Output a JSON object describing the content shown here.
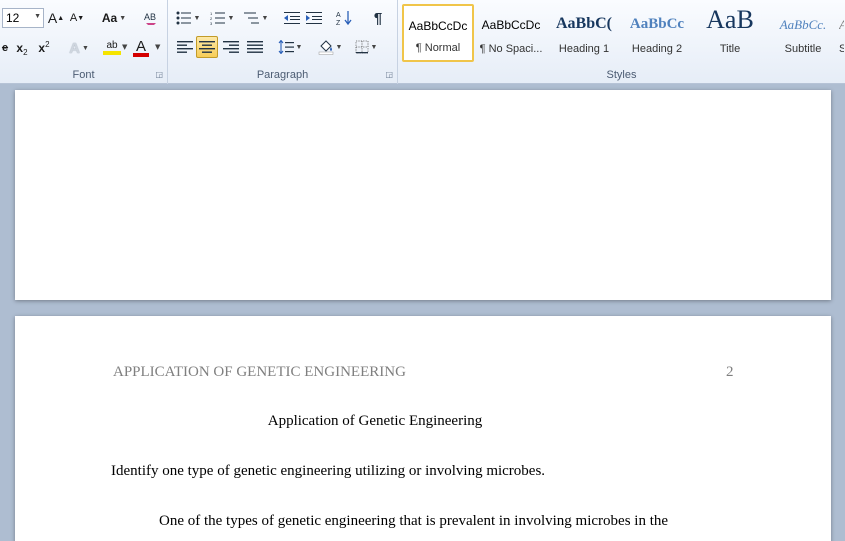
{
  "font_group": {
    "label": "Font",
    "font_size": "12",
    "grow_font": "A",
    "shrink_font": "A",
    "change_case": "Aa",
    "clear_format": "A",
    "subscript": "x",
    "superscript": "x",
    "text_effects": "A",
    "highlight": "ab",
    "font_color": "A",
    "highlight_color": "#f5e400",
    "font_color_bar": "#d40000"
  },
  "paragraph_group": {
    "label": "Paragraph",
    "show_marks": "¶"
  },
  "styles_group": {
    "label": "Styles",
    "items": [
      {
        "sample": "AaBbCcDc",
        "name": "¶ Normal",
        "selected": true
      },
      {
        "sample": "AaBbCcDc",
        "name": "¶ No Spaci..."
      },
      {
        "sample": "AaBbC(",
        "name": "Heading 1"
      },
      {
        "sample": "AaBbCc",
        "name": "Heading 2"
      },
      {
        "sample": "AaB",
        "name": "Title"
      },
      {
        "sample": "AaBbCc.",
        "name": "Subtitle"
      },
      {
        "sample": "A",
        "name": "S"
      }
    ]
  },
  "document": {
    "header_text": "APPLICATION OF GENETIC ENGINEERING",
    "page_number": "2",
    "title": "Application of Genetic Engineering",
    "question": "Identify one type of genetic engineering utilizing or involving microbes.",
    "paragraph_start": "One of the types of genetic engineering that is prevalent in involving microbes in the"
  }
}
